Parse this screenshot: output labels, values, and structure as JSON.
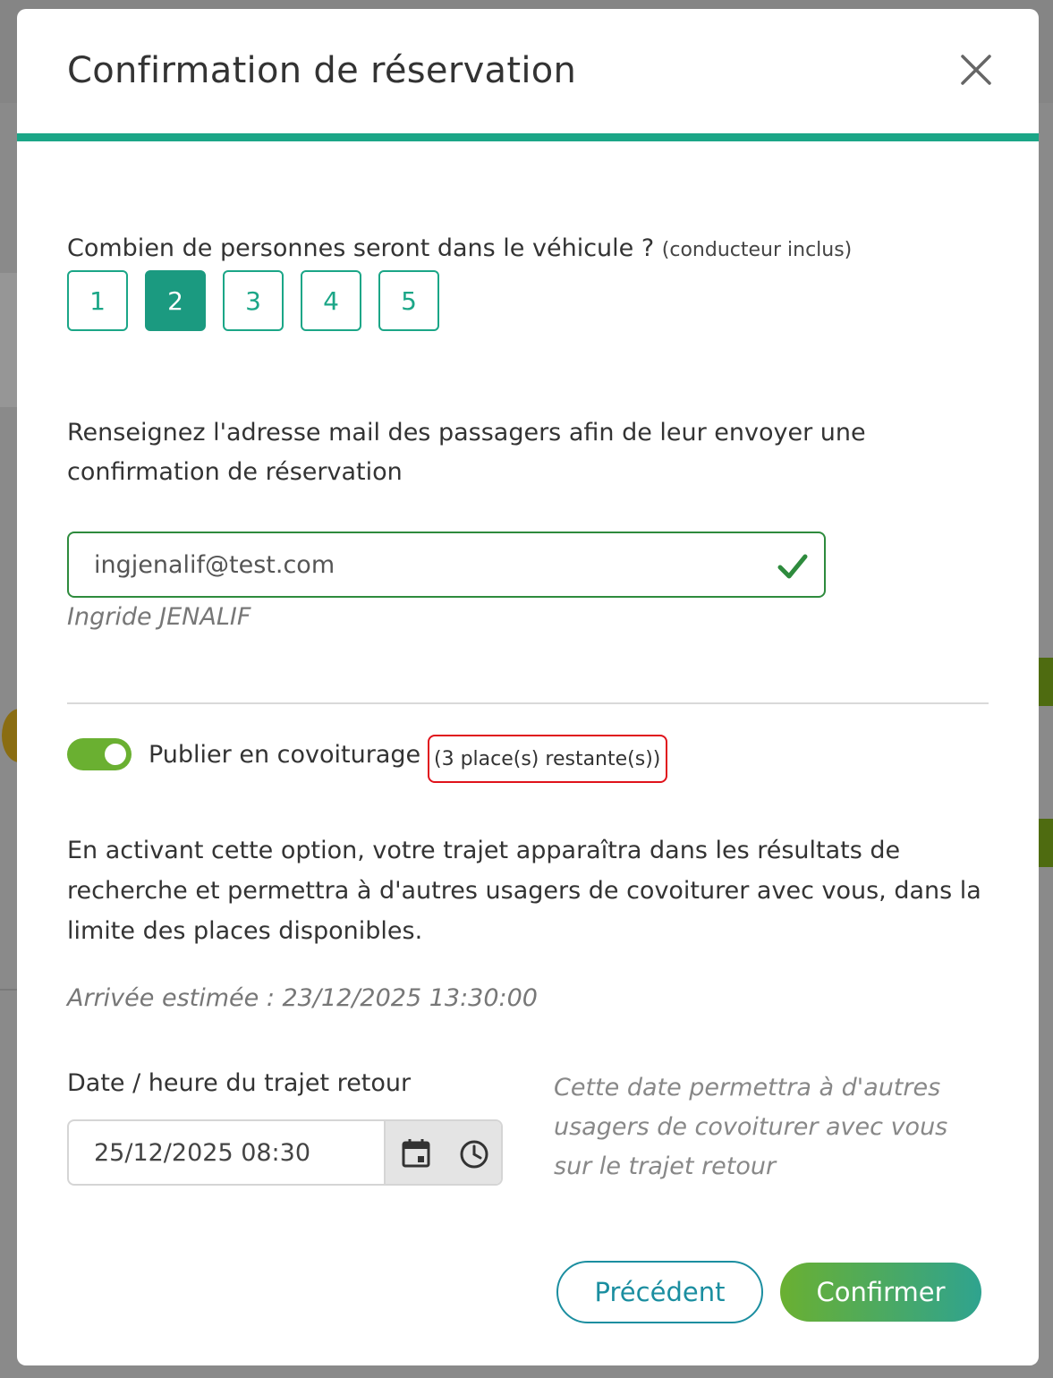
{
  "modal": {
    "title": "Confirmation de réservation",
    "close_icon": "close-icon"
  },
  "passengers": {
    "question": "Combien de personnes seront dans le véhicule ?",
    "hint": "(conducteur inclus)",
    "options": [
      "1",
      "2",
      "3",
      "4",
      "5"
    ],
    "selected": "2"
  },
  "email": {
    "intro": "Renseignez l'adresse mail des passagers afin de leur envoyer une confirmation de réservation",
    "value": "ingjenalif@test.com",
    "valid_icon": "check-icon",
    "passenger_name": "Ingride JENALIF"
  },
  "carpool": {
    "toggle_on": true,
    "label": "Publier en covoiturage",
    "seats_left": "(3 place(s) restante(s))",
    "description": "En activant cette option, votre trajet apparaîtra dans les résultats de recherche et permettra à d'autres usagers de covoiturer avec vous, dans la limite des places disponibles.",
    "eta": "Arrivée estimée : 23/12/2025 13:30:00"
  },
  "return_trip": {
    "label": "Date / heure du trajet retour",
    "value": "25/12/2025 08:30",
    "note": "Cette date permettra à d'autres usagers de covoiturer avec vous sur le trajet retour",
    "calendar_icon": "calendar-icon",
    "clock_icon": "clock-icon"
  },
  "actions": {
    "previous": "Précédent",
    "confirm": "Confirmer"
  },
  "colors": {
    "accent": "#1ba687",
    "toggle": "#6ab031",
    "valid_border": "#2e8b3d",
    "highlight_box": "#e0121b",
    "confirm_gradient_start": "#6ab031",
    "confirm_gradient_end": "#2fa38f"
  }
}
